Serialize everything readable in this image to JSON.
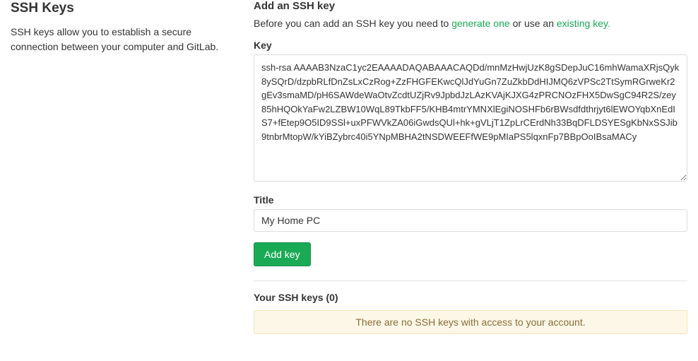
{
  "sidebar": {
    "title": "SSH Keys",
    "description": "SSH keys allow you to establish a secure connection between your computer and GitLab."
  },
  "form": {
    "heading": "Add an SSH key",
    "helper_prefix": "Before you can add an SSH key you need to ",
    "generate_link": "generate one",
    "helper_middle": " or use an ",
    "existing_link": "existing key.",
    "key_label": "Key",
    "key_value": "ssh-rsa AAAAB3NzaC1yc2EAAAADAQABAAACAQDd/mnMzHwjUzK8gSDepJuC16mhWamaXRjsQyk8ySQrD/dzpbRLfDnZsLxCzRog+ZzFHGFEKwcQlJdYuGn7ZuZkbDdHIJMQ6zVPSc2TtSymRGrweKr2gEv3smaMD/pH6SAWdeWaOtvZcdtUZjRv9JpbdJzLAzKVAjKJXG4zPRCNOzFHX5DwSgC94R2S/zey85hHQOkYaFw2LZBW10WqL89TkbFF5/KHB4mtrYMNXlEgiNOSHFb6rBWsdfdthrjyt6lEWOYqbXnEdIS7+fEtep9O5ID9SSl+uxPFWVkZA06iGwdsQUl+hk+gVLjT1ZpLrCErdNh33BqDFLDSYESgKbNxSSJib9tnbrMtopW/kYiBZybrc40i5YNpMBHA2tNSDWEEFfWE9pMIaPS5lqxnFp7BBpOoIBsaMACy",
    "title_label": "Title",
    "title_value": "My Home PC",
    "submit_label": "Add key"
  },
  "keys_list": {
    "heading": "Your SSH keys (0)",
    "empty_message": "There are no SSH keys with access to your account."
  }
}
